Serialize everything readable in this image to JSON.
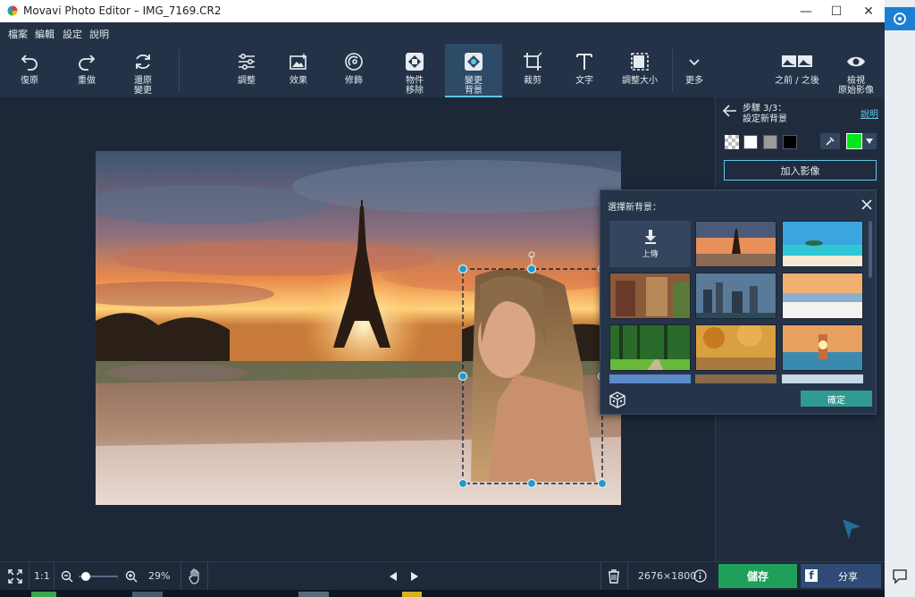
{
  "window": {
    "title": "Movavi Photo Editor – IMG_7169.CR2"
  },
  "menu": [
    "檔案",
    "編輯",
    "設定",
    "說明"
  ],
  "toolbar": {
    "undo": "復原",
    "redo": "重做",
    "reset": "還原\n變更",
    "adjust": "調整",
    "effects": "效果",
    "retouch": "修飾",
    "object_removal": "物件\n移除",
    "change_bg": "變更\n背景",
    "crop": "裁剪",
    "text": "文字",
    "resize": "調整大小",
    "more": "更多",
    "before_after": "之前 / 之後",
    "view_original": "檢視\n原始影像"
  },
  "panel": {
    "step": "步驟 3/3：",
    "step_title": "設定新背景",
    "help": "說明",
    "add_image": "加入影像",
    "colors": [
      "#ffffff",
      "#9a9a9a",
      "#000000"
    ],
    "picked_color": "#00e81c"
  },
  "popup": {
    "title": "選擇新背景：",
    "upload": "上傳",
    "confirm": "確定"
  },
  "bottom": {
    "ratio": "1:1",
    "zoom": "29%",
    "zoom_fraction": 0.1,
    "dimensions": "2676×1800",
    "save": "儲存",
    "share": "分享"
  }
}
